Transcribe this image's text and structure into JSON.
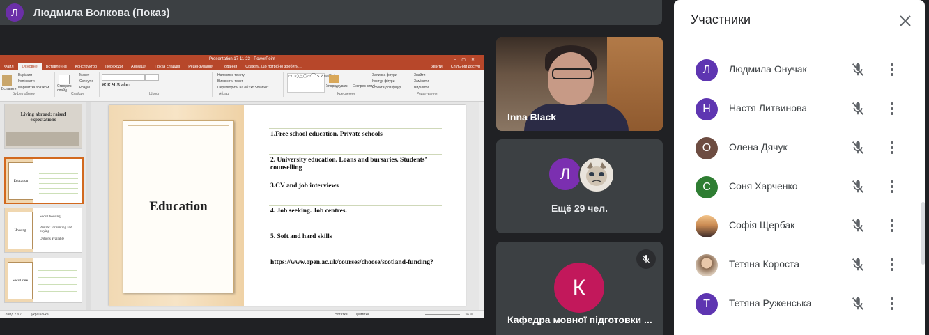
{
  "presenter": {
    "avatar_letter": "Л",
    "name": "Людмила Волкова (Показ)",
    "avatar_color": "#6b2fa8"
  },
  "powerpoint": {
    "window_title": "Presentation 17-11-23 - PowerPoint",
    "tabs": [
      "Файл",
      "Основне",
      "Вставлення",
      "Конструктор",
      "Переходи",
      "Анімація",
      "Показ слайдів",
      "Рецензування",
      "Подання",
      "Скажіть, що потрібно зробити..."
    ],
    "active_tab": "Основне",
    "account": "Увійти",
    "share_label": "Спільний доступ",
    "ribbon": {
      "clipboard": {
        "paste": "Вставити",
        "cut": "Вирізати",
        "copy": "Копіювати",
        "format": "Формат за зразком",
        "label": "Буфер обміну"
      },
      "slides": {
        "new": "Створити слайд",
        "layout": "Макет",
        "reset": "Скинути",
        "section": "Розділ",
        "label": "Слайди"
      },
      "font": {
        "label": "Шрифт"
      },
      "paragraph": {
        "dir": "Напрямок тексту",
        "align": "Вирівняти текст",
        "smartart": "Перетворити на об'єкт SmartArt",
        "label": "Абзац"
      },
      "drawing": {
        "arrange": "Упорядкувати",
        "styles": "Експрес-стилі",
        "fill": "Заливка фігури",
        "outline": "Контур фігури",
        "effects": "Ефекти для фігур",
        "label": "Креслення"
      },
      "editing": {
        "find": "Знайти",
        "replace": "Замінити",
        "select": "Виділити",
        "label": "Редагування"
      }
    },
    "thumbnails": [
      {
        "title": "Living abroad: raised expectations"
      },
      {
        "title": "Education"
      },
      {
        "title": "Housing",
        "lines": [
          "Social housing",
          "Private: for renting and buying",
          "Options available"
        ]
      },
      {
        "title": "Social care"
      }
    ],
    "slide": {
      "title": "Education",
      "items": [
        "1.Free school education. Private schools",
        "2.  University education. Loans and bursaries. Students’ counselling",
        "3.CV and job interviews",
        "4. Job seeking. Job centres.",
        "5. Soft and hard skills",
        "https://www.open.ac.uk/courses/choose/scotland-funding?"
      ]
    },
    "status": {
      "slide_info": "Слайд 2 з 7",
      "language": "українська",
      "notes": "Нотатки",
      "comments": "Примітки",
      "zoom": "56 %"
    }
  },
  "tiles": [
    {
      "name": "Inna Black",
      "type": "camera"
    },
    {
      "more_label": "Ещё 29 чел.",
      "avatar_letter": "Л",
      "avatar_color": "#7b2fb0"
    },
    {
      "name": "Кафедра мовної підготовки ...",
      "avatar_letter": "К",
      "avatar_color": "#c2185b",
      "muted": true
    }
  ],
  "panel": {
    "title": "Участники",
    "participants": [
      {
        "name": "Людмила Онучак",
        "letter": "Л",
        "color": "#5e35b1"
      },
      {
        "name": "Настя Литвинова",
        "letter": "Н",
        "color": "#5e35b1"
      },
      {
        "name": "Олена Дячук",
        "letter": "О",
        "color": "#6d4c41"
      },
      {
        "name": "Соня Харченко",
        "letter": "С",
        "color": "#2e7d32"
      },
      {
        "name": "Софія Щербак",
        "letter": "",
        "color": "#8d6e63"
      },
      {
        "name": "Тетяна Короста",
        "letter": "",
        "color": "#a1887f"
      },
      {
        "name": "Тетяна Руженська",
        "letter": "Т",
        "color": "#5e35b1"
      }
    ]
  }
}
